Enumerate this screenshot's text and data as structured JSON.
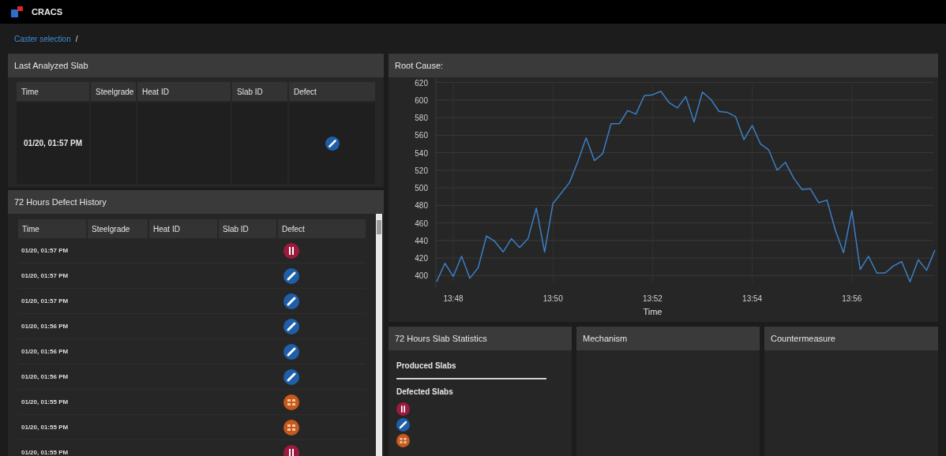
{
  "app": {
    "title": "CRACS"
  },
  "breadcrumb": {
    "link": "Caster selection",
    "separator": "/"
  },
  "last_analyzed": {
    "title": "Last Analyzed Slab",
    "columns": [
      "Time",
      "Steelgrade",
      "Heat ID",
      "Slab ID",
      "Defect"
    ],
    "row": {
      "time": "01/20, 01:57 PM",
      "defect": {
        "kind": "slash",
        "color": "#1f5fa8"
      }
    }
  },
  "history": {
    "title": "72 Hours Defect History",
    "columns": [
      "Time",
      "Steelgrade",
      "Heat ID",
      "Slab ID",
      "Defect"
    ],
    "rows": [
      {
        "time": "01/20, 01:57 PM",
        "defect": {
          "kind": "bars",
          "color": "#9b1b3f"
        }
      },
      {
        "time": "01/20, 01:57 PM",
        "defect": {
          "kind": "slash",
          "color": "#1f5fa8"
        }
      },
      {
        "time": "01/20, 01:57 PM",
        "defect": {
          "kind": "slash",
          "color": "#1f5fa8"
        }
      },
      {
        "time": "01/20, 01:56 PM",
        "defect": {
          "kind": "slash",
          "color": "#1f5fa8"
        }
      },
      {
        "time": "01/20, 01:56 PM",
        "defect": {
          "kind": "slash",
          "color": "#1f5fa8"
        }
      },
      {
        "time": "01/20, 01:56 PM",
        "defect": {
          "kind": "slash",
          "color": "#1f5fa8"
        }
      },
      {
        "time": "01/20, 01:55 PM",
        "defect": {
          "kind": "grid",
          "color": "#c55a1c"
        }
      },
      {
        "time": "01/20, 01:55 PM",
        "defect": {
          "kind": "grid",
          "color": "#c55a1c"
        }
      },
      {
        "time": "01/20, 01:55 PM",
        "defect": {
          "kind": "bars",
          "color": "#9b1b3f"
        }
      }
    ]
  },
  "root_cause": {
    "title": "Root Cause:",
    "chart_data": {
      "type": "line",
      "xlabel": "Time",
      "grid": true,
      "ylim": [
        385,
        625
      ],
      "categories": [
        null,
        null,
        "13:48",
        null,
        null,
        null,
        null,
        null,
        null,
        null,
        null,
        null,
        null,
        null,
        "13:50",
        null,
        null,
        null,
        null,
        null,
        null,
        null,
        null,
        null,
        null,
        null,
        "13:52",
        null,
        null,
        null,
        null,
        null,
        null,
        null,
        null,
        null,
        null,
        null,
        "13:54",
        null,
        null,
        null,
        null,
        null,
        null,
        null,
        null,
        null,
        null,
        null,
        "13:56",
        null,
        null,
        null,
        null,
        null,
        null,
        null,
        null,
        null,
        null
      ],
      "series": [
        {
          "color": "#3b7fc4",
          "values": [
            393,
            414,
            399,
            422,
            397,
            409,
            445,
            439,
            427,
            442,
            432,
            442,
            477,
            427,
            482,
            494,
            506,
            530,
            557,
            531,
            539,
            573,
            573,
            588,
            584,
            605,
            606,
            610,
            597,
            591,
            604,
            575,
            609,
            601,
            587,
            586,
            581,
            555,
            571,
            550,
            543,
            520,
            529,
            511,
            498,
            499,
            483,
            486,
            452,
            426,
            474,
            407,
            422,
            403,
            403,
            411,
            416,
            393,
            418,
            406,
            429
          ]
        }
      ],
      "yticks": [
        400,
        420,
        440,
        460,
        480,
        500,
        520,
        540,
        560,
        580,
        600,
        620
      ]
    }
  },
  "slab_statistics": {
    "title": "72 Hours Slab Statistics",
    "produced_label": "Produced Slabs",
    "defected_label": "Defected Slabs",
    "defected": [
      {
        "kind": "bars",
        "color": "#9b1b3f"
      },
      {
        "kind": "slash",
        "color": "#1f5fa8"
      },
      {
        "kind": "grid",
        "color": "#c55a1c"
      }
    ]
  },
  "mechanism": {
    "title": "Mechanism"
  },
  "countermeasure": {
    "title": "Countermeasure"
  }
}
